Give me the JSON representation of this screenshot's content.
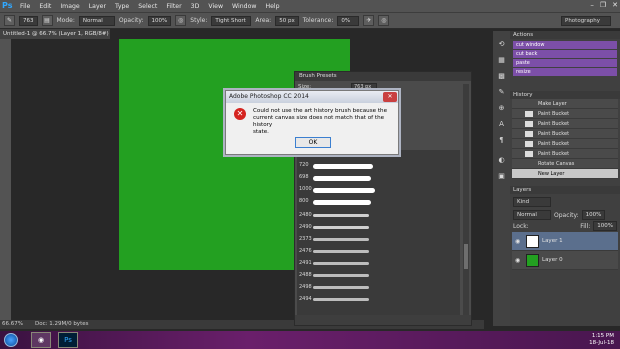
{
  "menubar": {
    "logo": "Ps",
    "items": [
      "File",
      "Edit",
      "Image",
      "Layer",
      "Type",
      "Select",
      "Filter",
      "3D",
      "View",
      "Window",
      "Help"
    ],
    "window_controls": [
      "–",
      "❐",
      "✕"
    ]
  },
  "options": {
    "brush_size": "763",
    "mode_label": "Mode:",
    "mode": "Normal",
    "opacity_label": "Opacity:",
    "opacity": "100%",
    "style_label": "Style:",
    "style": "Tight Short",
    "area_label": "Area:",
    "area": "50 px",
    "tolerance_label": "Tolerance:",
    "tolerance": "0%",
    "workspace": "Photography"
  },
  "document": {
    "tab": "Untitled-1 @ 66.7% (Layer 1, RGB/8#) *",
    "canvas_color": "#23a021"
  },
  "status": {
    "zoom": "66.67%",
    "doc": "Doc: 1.29M/0 bytes"
  },
  "brush_presets": {
    "title": "Brush Presets",
    "size_label": "Size:",
    "size_value": "763 px",
    "numbers": [
      "763",
      "720",
      "698",
      "1000",
      "800",
      "2480",
      "2490",
      "2373",
      "2476",
      "2491",
      "2488",
      "2498",
      "2494"
    ]
  },
  "dialog": {
    "title": "Adobe Photoshop CC 2014",
    "message": "Could not use the art history brush because the\ncurrent canvas size does not match that of the history\nstate.",
    "ok": "OK"
  },
  "actions": {
    "title": "Actions",
    "items": [
      "cut window",
      "cut back",
      "paste",
      "resize"
    ]
  },
  "history": {
    "title": "History",
    "items": [
      "Make Layer",
      "Paint Bucket",
      "Paint Bucket",
      "Paint Bucket",
      "Paint Bucket",
      "Paint Bucket",
      "Rotate Canvas",
      "New Layer"
    ]
  },
  "layers": {
    "title": "Layers",
    "kind": "Kind",
    "blend": "Normal",
    "opacity_label": "Opacity:",
    "opacity": "100%",
    "lock_label": "Lock:",
    "fill_label": "Fill:",
    "fill": "100%",
    "items": [
      {
        "name": "Layer 1"
      },
      {
        "name": "Layer 0"
      }
    ]
  },
  "taskbar": {
    "time": "1:15 PM",
    "date": "18-Jul-18"
  }
}
